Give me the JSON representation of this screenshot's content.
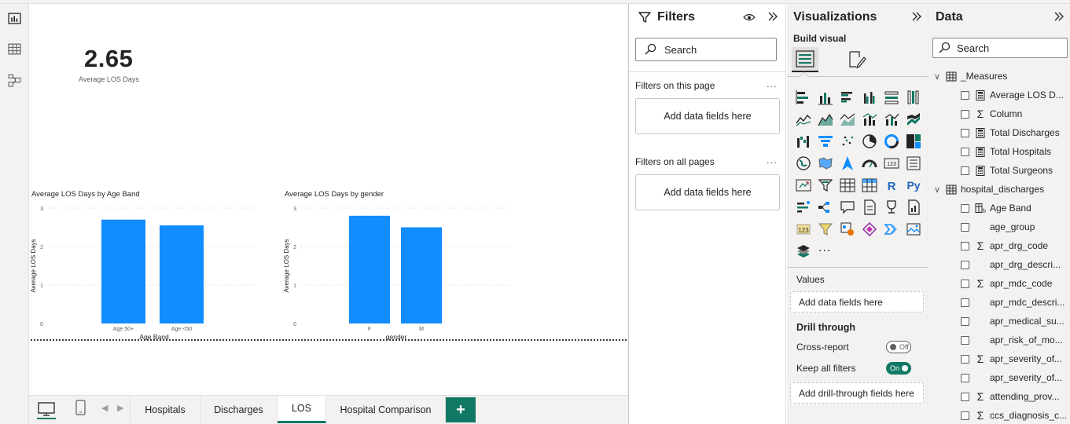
{
  "rail": {
    "items": [
      "report-view",
      "table-view",
      "model-view"
    ]
  },
  "canvas": {
    "card": {
      "value": "2.65",
      "label": "Average LOS Days"
    },
    "charts": [
      {
        "title": "Average LOS Days by Age Band"
      },
      {
        "title": "Average LOS Days by gender"
      }
    ]
  },
  "chart_data": [
    {
      "type": "bar",
      "title": "Average LOS Days by Age Band",
      "xlabel": "Age Band",
      "ylabel": "Average LOS Days",
      "categories": [
        "Age 50+",
        "Age <50"
      ],
      "values": [
        2.7,
        2.55
      ],
      "ylim": [
        0,
        3
      ],
      "yticks": [
        "0",
        "1",
        "2",
        "3"
      ],
      "grid": true,
      "color": "#118DFF"
    },
    {
      "type": "bar",
      "title": "Average LOS Days by gender",
      "xlabel": "gender",
      "ylabel": "Average LOS Days",
      "categories": [
        "F",
        "M"
      ],
      "values": [
        2.8,
        2.5
      ],
      "ylim": [
        0,
        3
      ],
      "yticks": [
        "0",
        "1",
        "2",
        "3"
      ],
      "grid": true,
      "color": "#118DFF"
    }
  ],
  "tabs": {
    "pages": [
      {
        "label": "Hospitals",
        "active": false
      },
      {
        "label": "Discharges",
        "active": false
      },
      {
        "label": "LOS",
        "active": true
      },
      {
        "label": "Hospital Comparison",
        "active": false
      }
    ],
    "add_label": "+"
  },
  "filters": {
    "title": "Filters",
    "search_placeholder": "Search",
    "on_this_page": "Filters on this page",
    "on_all_pages": "Filters on all pages",
    "well_text": "Add data fields here",
    "more": "..."
  },
  "visualizations": {
    "title": "Visualizations",
    "build_visual": "Build visual",
    "values_label": "Values",
    "values_well": "Add data fields here",
    "drill_through": "Drill through",
    "cross_report": "Cross-report",
    "cross_report_state": "Off",
    "keep_all_filters": "Keep all filters",
    "keep_all_filters_state": "On",
    "drill_well": "Add drill-through fields here",
    "more": "..."
  },
  "data_pane": {
    "title": "Data",
    "search_placeholder": "Search",
    "tables": [
      {
        "name": "_Measures",
        "fields": [
          {
            "name": "Average LOS D...",
            "icon": "calculator-icon"
          },
          {
            "name": "Column",
            "icon": "sigma-icon"
          },
          {
            "name": "Total Discharges",
            "icon": "calculator-icon"
          },
          {
            "name": "Total Hospitals",
            "icon": "calculator-icon"
          },
          {
            "name": "Total Surgeons",
            "icon": "calculator-icon"
          }
        ]
      },
      {
        "name": "hospital_discharges",
        "fields": [
          {
            "name": "Age Band",
            "icon": "calculated-column-icon"
          },
          {
            "name": "age_group",
            "icon": ""
          },
          {
            "name": "apr_drg_code",
            "icon": "sigma-icon"
          },
          {
            "name": "apr_drg_descri...",
            "icon": ""
          },
          {
            "name": "apr_mdc_code",
            "icon": "sigma-icon"
          },
          {
            "name": "apr_mdc_descri...",
            "icon": ""
          },
          {
            "name": "apr_medical_su...",
            "icon": ""
          },
          {
            "name": "apr_risk_of_mo...",
            "icon": ""
          },
          {
            "name": "apr_severity_of...",
            "icon": "sigma-icon"
          },
          {
            "name": "apr_severity_of...",
            "icon": ""
          },
          {
            "name": "attending_prov...",
            "icon": "sigma-icon"
          },
          {
            "name": "ccs_diagnosis_c...",
            "icon": "sigma-icon"
          }
        ]
      }
    ]
  }
}
